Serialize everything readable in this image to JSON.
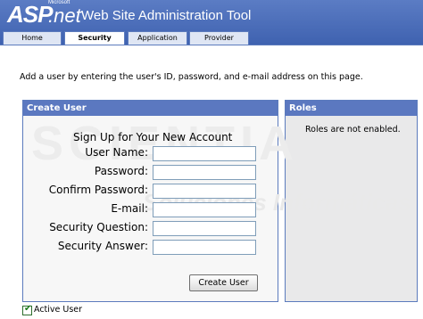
{
  "header": {
    "logo_asp": "ASP",
    "logo_net": ".net",
    "logo_ms": "Microsoft",
    "title": "Web Site Administration Tool"
  },
  "tabs": [
    {
      "label": "Home"
    },
    {
      "label": "Security"
    },
    {
      "label": "Application"
    },
    {
      "label": "Provider"
    }
  ],
  "intro": "Add a user by entering the user's ID, password, and e-mail address on this page.",
  "create_user": {
    "heading": "Create User",
    "signup_title": "Sign Up for Your New Account",
    "labels": {
      "user_name": "User Name:",
      "password": "Password:",
      "confirm_password": "Confirm Password:",
      "email": "E-mail:",
      "security_question": "Security Question:",
      "security_answer": "Security Answer:"
    },
    "button": "Create User"
  },
  "roles": {
    "heading": "Roles",
    "message": "Roles are not enabled."
  },
  "watermark": {
    "line1": "SCIENTIA",
    "line2": "Soluciones Informáticas"
  },
  "active_user": {
    "label": "Active User",
    "checked": true
  },
  "colors": {
    "header": "#4f6fb8",
    "panel_head": "#5b78c0",
    "border": "#5c7bbd"
  }
}
